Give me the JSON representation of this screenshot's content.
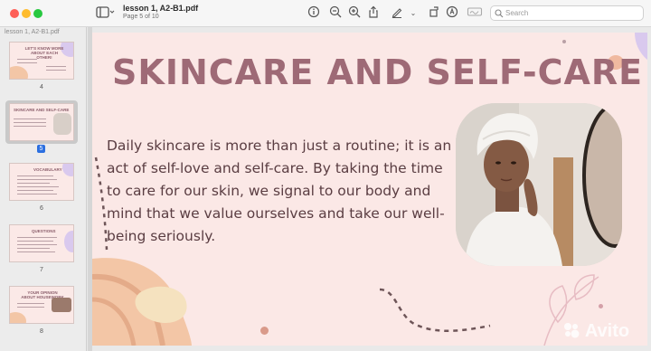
{
  "window": {
    "title": "lesson 1, A2-B1.pdf",
    "subtitle": "Page 5 of 10"
  },
  "toolbar": {
    "search_placeholder": "Search"
  },
  "sidebar": {
    "title": "lesson 1, A2-B1.pdf",
    "thumbnails": [
      {
        "page": "4",
        "heading": "LET'S KNOW MORE ABOUT EACH OTHER!"
      },
      {
        "page": "5",
        "heading": "SKINCARE AND SELF-CARE",
        "selected": true
      },
      {
        "page": "6",
        "heading": "VOCABULARY"
      },
      {
        "page": "7",
        "heading": "QUESTIONS"
      },
      {
        "page": "8",
        "heading": "YOUR OPINION ABOUT HOUSEWORK"
      }
    ]
  },
  "slide": {
    "title": "SKINCARE AND SELF-CARE",
    "body": "Daily skincare is more than just a routine; it is an act of self-love and self-care. By taking the time to care for our skin, we signal to our body and mind that we value ourselves and take our well-being seriously.",
    "watermark": "Avito"
  },
  "colors": {
    "title": "#9e6a76",
    "slide_bg": "#fbe8e6",
    "accent_peach": "#f3c6a6",
    "accent_blob": "#f5e2bf"
  }
}
